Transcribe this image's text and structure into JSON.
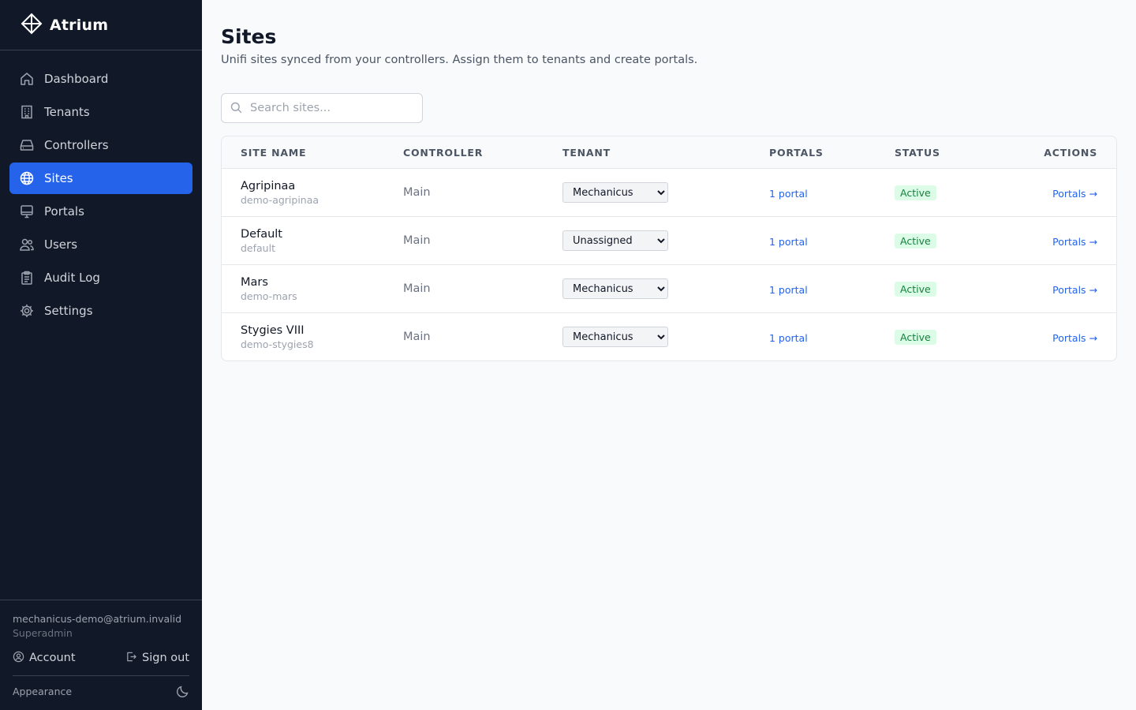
{
  "brand": {
    "name": "Atrium"
  },
  "nav": {
    "items": [
      {
        "label": "Dashboard",
        "icon": "home-icon"
      },
      {
        "label": "Tenants",
        "icon": "building-icon"
      },
      {
        "label": "Controllers",
        "icon": "server-icon"
      },
      {
        "label": "Sites",
        "icon": "globe-icon",
        "active": true
      },
      {
        "label": "Portals",
        "icon": "monitor-icon"
      },
      {
        "label": "Users",
        "icon": "users-icon"
      },
      {
        "label": "Audit Log",
        "icon": "clipboard-icon"
      },
      {
        "label": "Settings",
        "icon": "gear-icon"
      }
    ]
  },
  "footer": {
    "email": "mechanicus-demo@atrium.invalid",
    "role": "Superadmin",
    "account_label": "Account",
    "signout_label": "Sign out",
    "appearance_label": "Appearance"
  },
  "page": {
    "title": "Sites",
    "subtitle": "Unifi sites synced from your controllers. Assign them to tenants and create portals."
  },
  "search": {
    "placeholder": "Search sites..."
  },
  "table": {
    "headers": [
      "SITE NAME",
      "CONTROLLER",
      "TENANT",
      "PORTALS",
      "STATUS",
      "ACTIONS"
    ],
    "tenant_options": [
      "Unassigned",
      "Mechanicus"
    ],
    "rows": [
      {
        "name": "Agripinaa",
        "slug": "demo-agripinaa",
        "controller": "Main",
        "tenant": "Mechanicus",
        "portals": "1 portal",
        "status": "Active",
        "action": "Portals →"
      },
      {
        "name": "Default",
        "slug": "default",
        "controller": "Main",
        "tenant": "Unassigned",
        "portals": "1 portal",
        "status": "Active",
        "action": "Portals →"
      },
      {
        "name": "Mars",
        "slug": "demo-mars",
        "controller": "Main",
        "tenant": "Mechanicus",
        "portals": "1 portal",
        "status": "Active",
        "action": "Portals →"
      },
      {
        "name": "Stygies VIII",
        "slug": "demo-stygies8",
        "controller": "Main",
        "tenant": "Mechanicus",
        "portals": "1 portal",
        "status": "Active",
        "action": "Portals →"
      }
    ]
  },
  "colors": {
    "sidebar_bg": "#111827",
    "accent": "#2563eb",
    "status_active_bg": "#dcfce7",
    "status_active_text": "#15803d"
  }
}
